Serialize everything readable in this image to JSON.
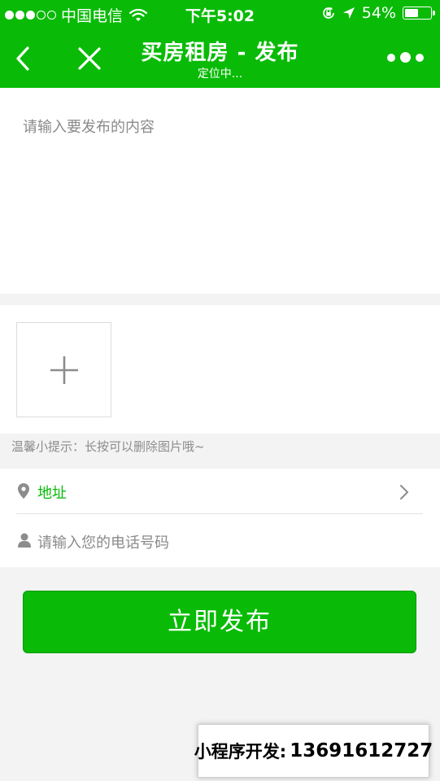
{
  "status_bar": {
    "carrier": "中国电信",
    "time": "下午5:02",
    "battery_text": "54%",
    "battery_level": 0.54,
    "signal_bars_filled": 3,
    "signal_bars_total": 5,
    "icons": [
      "wifi-icon",
      "rotation-lock-icon",
      "location-arrow-icon",
      "battery-icon"
    ]
  },
  "nav": {
    "title": "买房租房 - 发布",
    "subtitle": "定位中...",
    "icons": [
      "back-icon",
      "close-icon",
      "more-icon"
    ]
  },
  "content": {
    "placeholder": "请输入要发布的内容"
  },
  "images": {
    "add_icon": "plus-icon"
  },
  "tip": "温馨小提示：长按可以删除图片哦~",
  "form": {
    "address_label": "地址",
    "address_icon": "location-pin-icon",
    "phone_placeholder": "请输入您的电话号码",
    "phone_icon": "user-icon"
  },
  "publish_button": "立即发布",
  "watermark": {
    "label": "小程序开发:",
    "phone": "13691612727"
  },
  "colors": {
    "brand_green": "#09bb07",
    "background": "#f3f3f3",
    "placeholder_gray": "#8a8a8a"
  }
}
